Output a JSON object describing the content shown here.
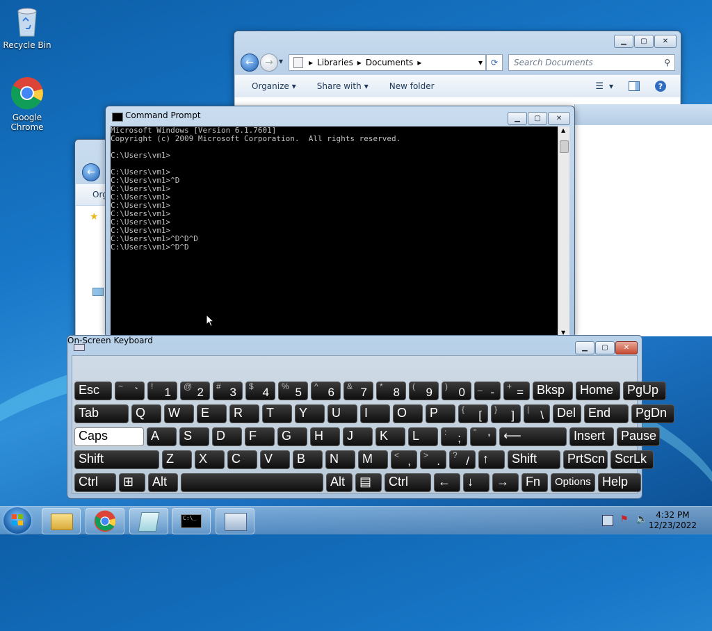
{
  "desktop": {
    "icons": [
      {
        "label": "Recycle Bin",
        "icon": "recycle-bin-icon"
      },
      {
        "label": "Google Chrome",
        "icon": "chrome-icon"
      }
    ]
  },
  "explorer_back": {
    "breadcrumb": [
      "Libraries",
      "Documents"
    ],
    "search_placeholder": "Search Documents",
    "toolbar": {
      "organize": "Organize",
      "share_with": "Share with",
      "new_folder": "New folder"
    },
    "glyphs": {
      "minimize": "▁",
      "maximize": "▢",
      "close": "✕",
      "back": "←",
      "forward": "→",
      "refresh": "⟳",
      "dropdown": "▾",
      "search": "⚲",
      "help": "?"
    }
  },
  "explorer_mid": {
    "organize_fragment": "Org"
  },
  "cmd": {
    "title": "Command Prompt",
    "lines": [
      "Microsoft Windows [Version 6.1.7601]",
      "Copyright (c) 2009 Microsoft Corporation.  All rights reserved.",
      "",
      "C:\\Users\\vm1>",
      "",
      "C:\\Users\\vm1>",
      "C:\\Users\\vm1>^D",
      "C:\\Users\\vm1>",
      "C:\\Users\\vm1>",
      "C:\\Users\\vm1>",
      "C:\\Users\\vm1>",
      "C:\\Users\\vm1>",
      "C:\\Users\\vm1>",
      "C:\\Users\\vm1>^D^D^D",
      "C:\\Users\\vm1>^D^D"
    ]
  },
  "osk": {
    "title": "On-Screen Keyboard",
    "rows": [
      [
        {
          "main": "Esc"
        },
        {
          "sub": "~",
          "main": "`"
        },
        {
          "sub": "!",
          "main": "1"
        },
        {
          "sub": "@",
          "main": "2"
        },
        {
          "sub": "#",
          "main": "3"
        },
        {
          "sub": "$",
          "main": "4"
        },
        {
          "sub": "%",
          "main": "5"
        },
        {
          "sub": "^",
          "main": "6"
        },
        {
          "sub": "&",
          "main": "7"
        },
        {
          "sub": "*",
          "main": "8"
        },
        {
          "sub": "(",
          "main": "9"
        },
        {
          "sub": ")",
          "main": "0"
        },
        {
          "sub": "_",
          "main": "-"
        },
        {
          "sub": "+",
          "main": "="
        },
        {
          "main": "Bksp"
        },
        {
          "main": "Home"
        },
        {
          "main": "PgUp"
        }
      ],
      [
        {
          "main": "Tab"
        },
        {
          "main": "Q"
        },
        {
          "main": "W"
        },
        {
          "main": "E"
        },
        {
          "main": "R"
        },
        {
          "main": "T"
        },
        {
          "main": "Y"
        },
        {
          "main": "U"
        },
        {
          "main": "I"
        },
        {
          "main": "O"
        },
        {
          "main": "P"
        },
        {
          "sub": "{",
          "main": "["
        },
        {
          "sub": "}",
          "main": "]"
        },
        {
          "sub": "|",
          "main": "\\"
        },
        {
          "main": "Del"
        },
        {
          "main": "End"
        },
        {
          "main": "PgDn"
        }
      ],
      [
        {
          "main": "Caps"
        },
        {
          "main": "A"
        },
        {
          "main": "S"
        },
        {
          "main": "D"
        },
        {
          "main": "F"
        },
        {
          "main": "G"
        },
        {
          "main": "H"
        },
        {
          "main": "J"
        },
        {
          "main": "K"
        },
        {
          "main": "L"
        },
        {
          "sub": ":",
          "main": ";"
        },
        {
          "sub": "\"",
          "main": "'"
        },
        {
          "main": "⟵"
        },
        {
          "main": "Insert"
        },
        {
          "main": "Pause"
        }
      ],
      [
        {
          "main": "Shift"
        },
        {
          "main": "Z"
        },
        {
          "main": "X"
        },
        {
          "main": "C"
        },
        {
          "main": "V"
        },
        {
          "main": "B"
        },
        {
          "main": "N"
        },
        {
          "main": "M"
        },
        {
          "sub": "<",
          "main": ","
        },
        {
          "sub": ">",
          "main": "."
        },
        {
          "sub": "?",
          "main": "/"
        },
        {
          "main": "↑"
        },
        {
          "main": "Shift"
        },
        {
          "main": "PrtScn"
        },
        {
          "main": "ScrLk"
        }
      ],
      [
        {
          "main": "Ctrl"
        },
        {
          "main": "⊞"
        },
        {
          "main": "Alt"
        },
        {
          "main": ""
        },
        {
          "main": "Alt"
        },
        {
          "main": "▤"
        },
        {
          "main": "Ctrl"
        },
        {
          "main": "←"
        },
        {
          "main": "↓"
        },
        {
          "main": "→"
        },
        {
          "main": "Fn"
        },
        {
          "main": "Options"
        },
        {
          "main": "Help"
        }
      ]
    ]
  },
  "taskbar": {
    "pinned": [
      "windows-explorer-icon",
      "chrome-icon",
      "notepad-icon",
      "command-prompt-icon",
      "on-screen-keyboard-icon"
    ],
    "clock_time": "4:32 PM",
    "clock_date": "12/23/2022"
  },
  "colors": {
    "console_bg": "#000000",
    "console_fg": "#c0c0c0",
    "caps_active": "#ffffff"
  }
}
